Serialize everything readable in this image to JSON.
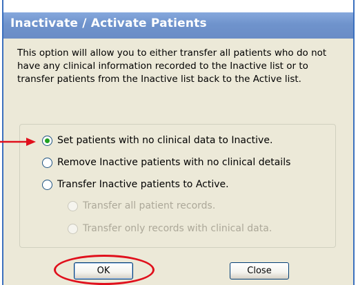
{
  "dialog": {
    "title": "Inactivate / Activate Patients",
    "description": "This option will allow you to either transfer all patients who do not have any clinical information recorded to the Inactive list or to transfer patients from the Inactive list back to the Active list.",
    "options": [
      {
        "label": "Set patients with no clinical data to Inactive.",
        "selected": true,
        "enabled": true
      },
      {
        "label": "Remove Inactive patients with no clinical details",
        "selected": false,
        "enabled": true
      },
      {
        "label": "Transfer Inactive patients to Active.",
        "selected": false,
        "enabled": true
      },
      {
        "label": "Transfer all patient records.",
        "selected": false,
        "enabled": false
      },
      {
        "label": "Transfer only records with clinical data.",
        "selected": false,
        "enabled": false
      }
    ],
    "ok_label": "OK",
    "close_label": "Close"
  },
  "colors": {
    "title_bar": "#7097cf",
    "dialog_background": "#ece9d8",
    "annotation": "#e0101c",
    "radio_dot": "#21a121"
  }
}
